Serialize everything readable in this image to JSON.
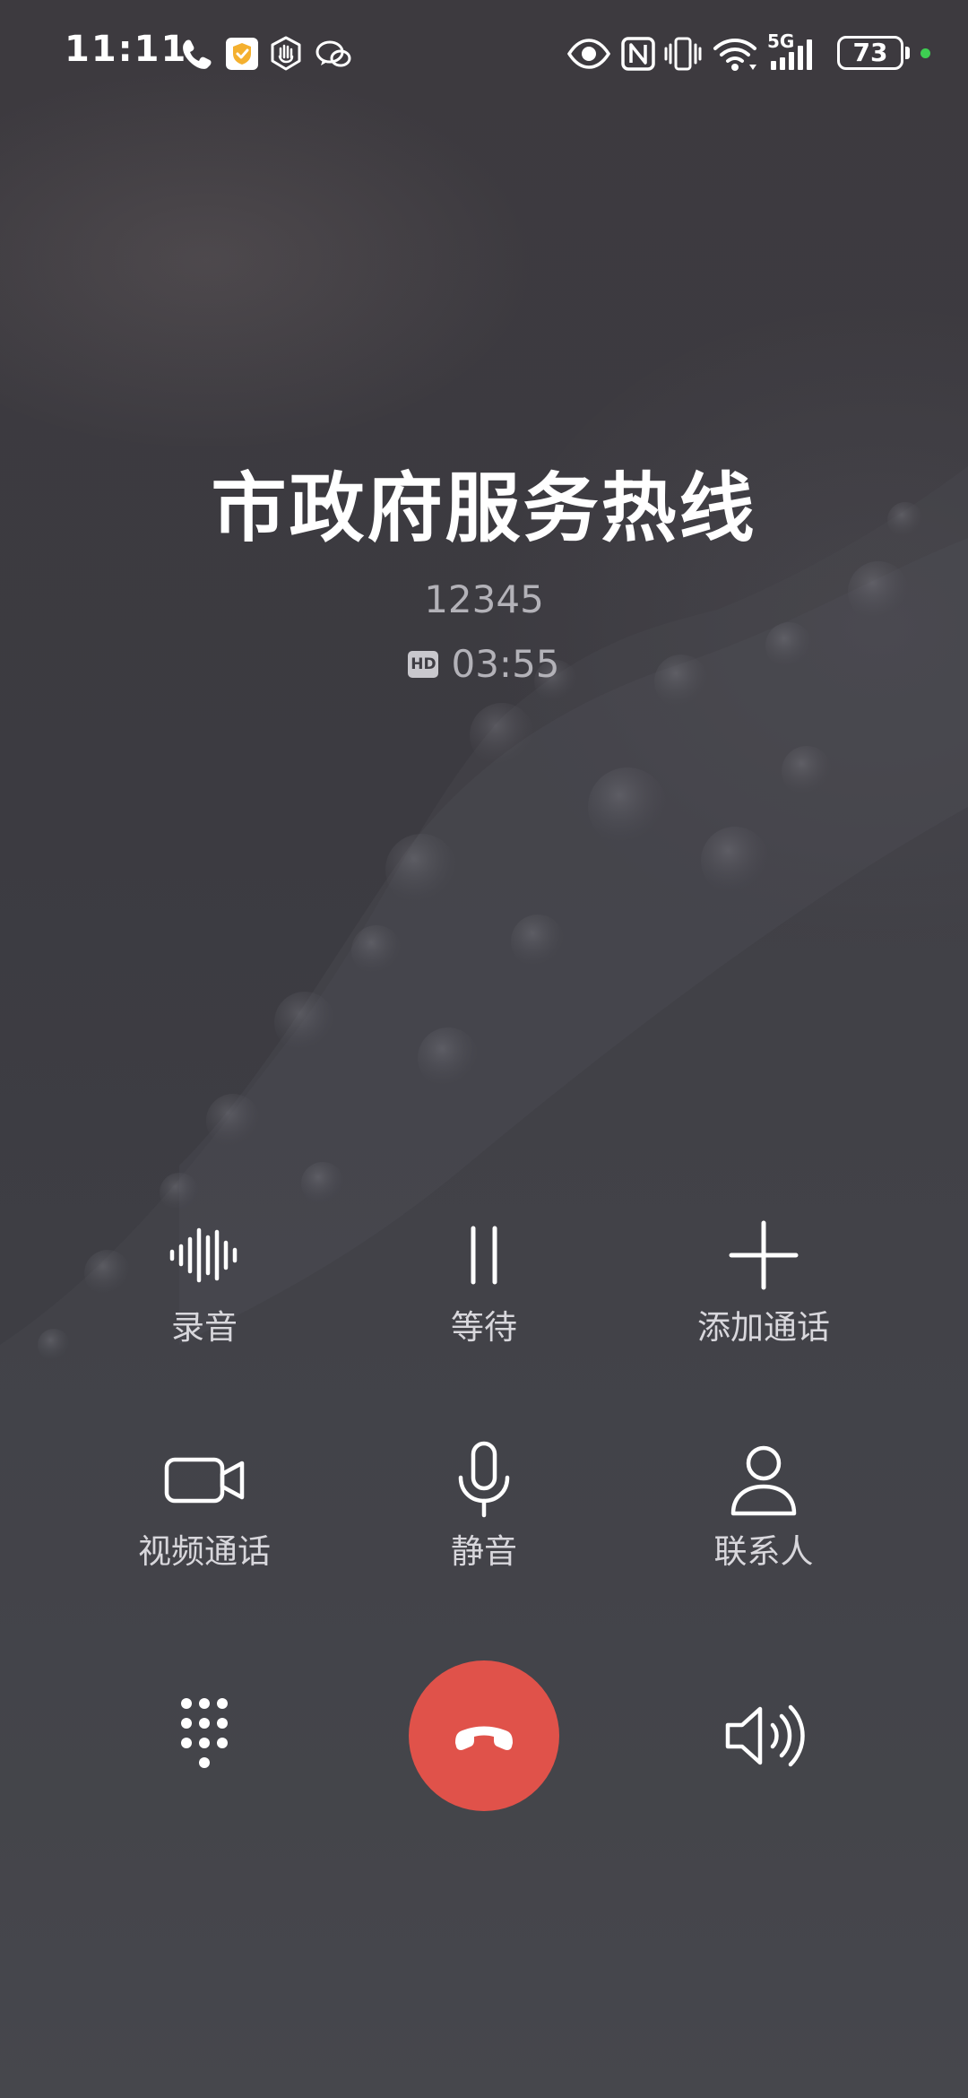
{
  "status_bar": {
    "time": "11:11",
    "network": "5G",
    "battery_level": "73",
    "icons": [
      "phone-icon",
      "shield-check-icon",
      "hand-stop-icon",
      "chat-bubbles-icon",
      "eye-icon",
      "nfc-icon",
      "vibrate-icon",
      "wifi-icon",
      "cellular-signal-icon",
      "battery-icon"
    ]
  },
  "call": {
    "caller_name": "市政府服务热线",
    "number": "12345",
    "hd_badge": "HD",
    "duration": "03:55"
  },
  "controls": [
    {
      "id": "record",
      "label": "录音",
      "icon": "waveform-icon"
    },
    {
      "id": "hold",
      "label": "等待",
      "icon": "pause-icon"
    },
    {
      "id": "add_call",
      "label": "添加通话",
      "icon": "plus-icon"
    },
    {
      "id": "video_call",
      "label": "视频通话",
      "icon": "video-camera-icon"
    },
    {
      "id": "mute",
      "label": "静音",
      "icon": "microphone-icon"
    },
    {
      "id": "contacts",
      "label": "联系人",
      "icon": "person-icon"
    }
  ],
  "bottom_bar": {
    "keypad_icon": "dialpad-icon",
    "end_call_icon": "hang-up-icon",
    "speaker_icon": "speaker-icon",
    "end_call_color": "#e0524a"
  },
  "colors": {
    "background": "#3d3c42",
    "text_primary": "#ffffff",
    "text_secondary": "#b3b2b8",
    "end_call": "#e0524a",
    "privacy_dot": "#3ecf52"
  }
}
